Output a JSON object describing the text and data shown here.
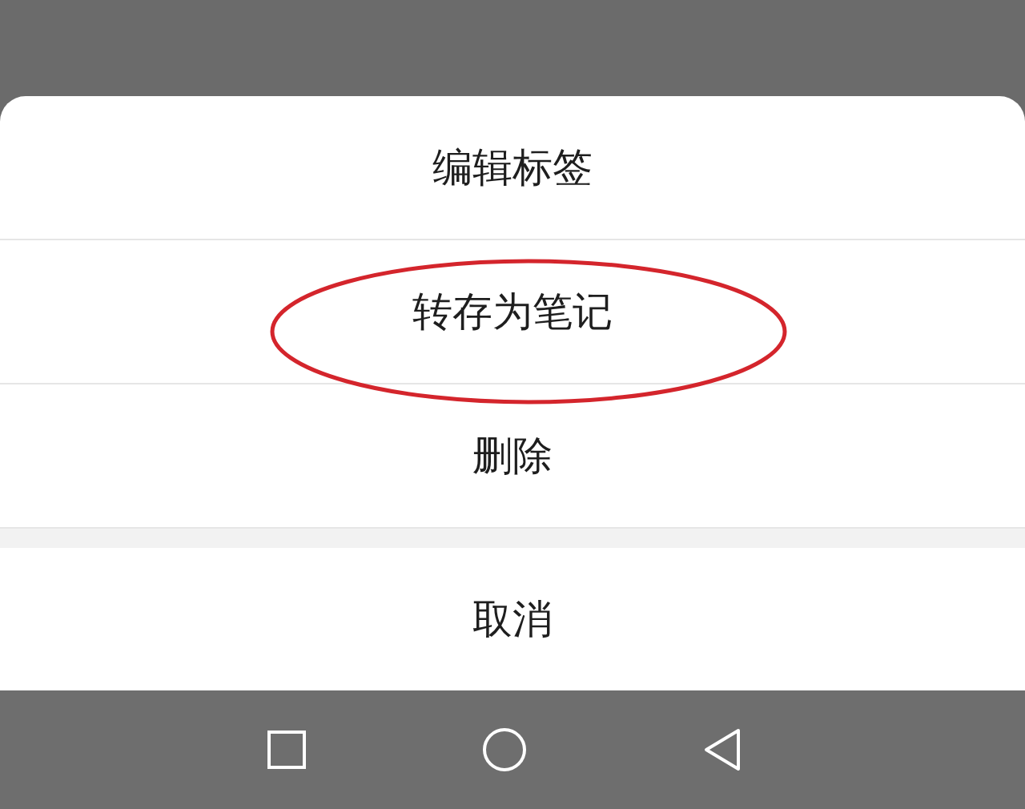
{
  "action_sheet": {
    "items": [
      {
        "label": "编辑标签",
        "highlighted": false
      },
      {
        "label": "转存为笔记",
        "highlighted": true
      },
      {
        "label": "删除",
        "highlighted": false
      }
    ],
    "cancel": "取消"
  },
  "nav_bar": {
    "buttons": [
      {
        "kind": "square"
      },
      {
        "kind": "circle"
      },
      {
        "kind": "triangle"
      }
    ]
  }
}
